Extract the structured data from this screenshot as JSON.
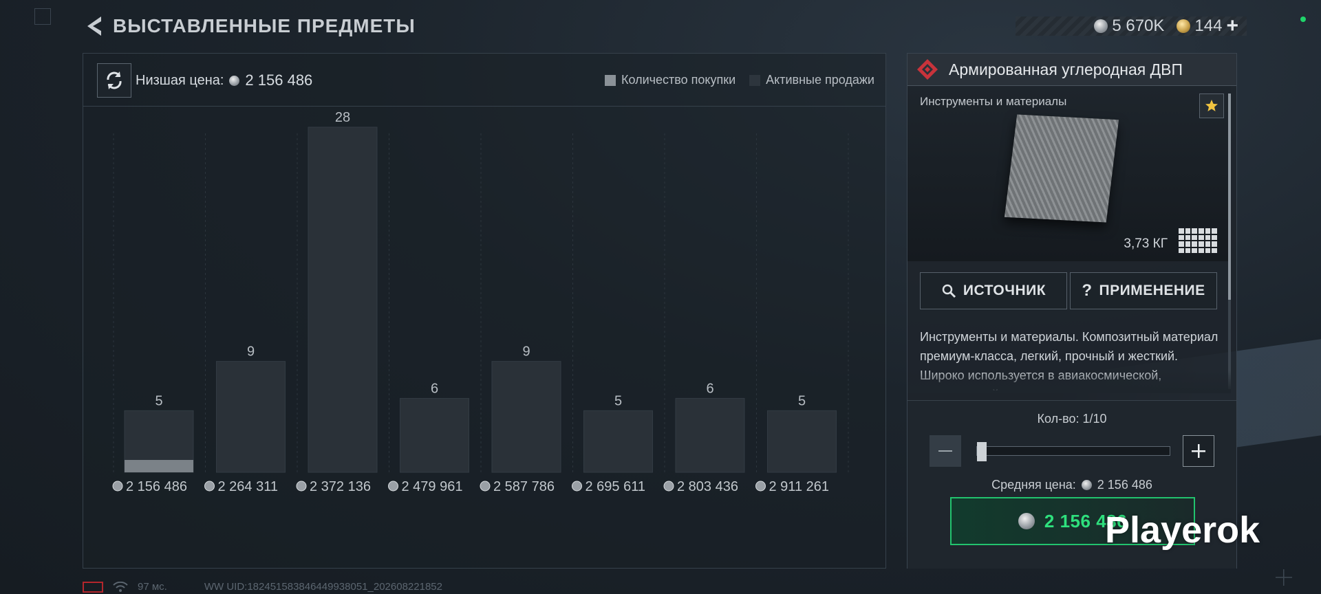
{
  "header": {
    "title": "ВЫСТАВЛЕННЫЕ ПРЕДМЕТЫ"
  },
  "currency": {
    "silver": "5 670K",
    "gold": "144"
  },
  "market": {
    "min_price_label": "Низшая цена:",
    "min_price": "2 156 486",
    "legend": {
      "purchase": "Количество покупки",
      "active": "Активные продажи"
    }
  },
  "chart_data": {
    "type": "bar",
    "categories": [
      "2 156 486",
      "2 264 311",
      "2 372 136",
      "2 479 961",
      "2 587 786",
      "2 695 611",
      "2 803 436",
      "2 911 261"
    ],
    "series": [
      {
        "name": "Активные продажи",
        "values": [
          5,
          9,
          28,
          6,
          9,
          5,
          6,
          5
        ]
      },
      {
        "name": "Количество покупки",
        "values": [
          1,
          0,
          0,
          0,
          0,
          0,
          0,
          0
        ]
      }
    ],
    "data_labels": [
      "5",
      "9",
      "28",
      "6",
      "9",
      "5",
      "6",
      "5"
    ],
    "ylim": [
      0,
      28
    ],
    "colors": {
      "active": "#2a3138",
      "purchase": "#7b8288"
    }
  },
  "item": {
    "name": "Армированная углеродная ДВП",
    "category": "Инструменты и материалы",
    "weight": "3,73 КГ",
    "source_label": "ИСТОЧНИК",
    "usage_label": "ПРИМЕНЕНИЕ",
    "description": "Инструменты и материалы. Композитный материал премиум-класса, легкий, прочный и жесткий. Широко используется в авиакосмической, строительной и других"
  },
  "purchase": {
    "qty_label": "Кол-во: 1/10",
    "qty_fraction": 0.1,
    "avg_price_label": "Средняя цена:",
    "avg_price": "2 156 486",
    "buy_price": "2 156 486"
  },
  "footer": {
    "ping": "97 мс.",
    "uid": "WW UID:182451583846449938051_202608221852"
  },
  "watermark": "Playerok"
}
